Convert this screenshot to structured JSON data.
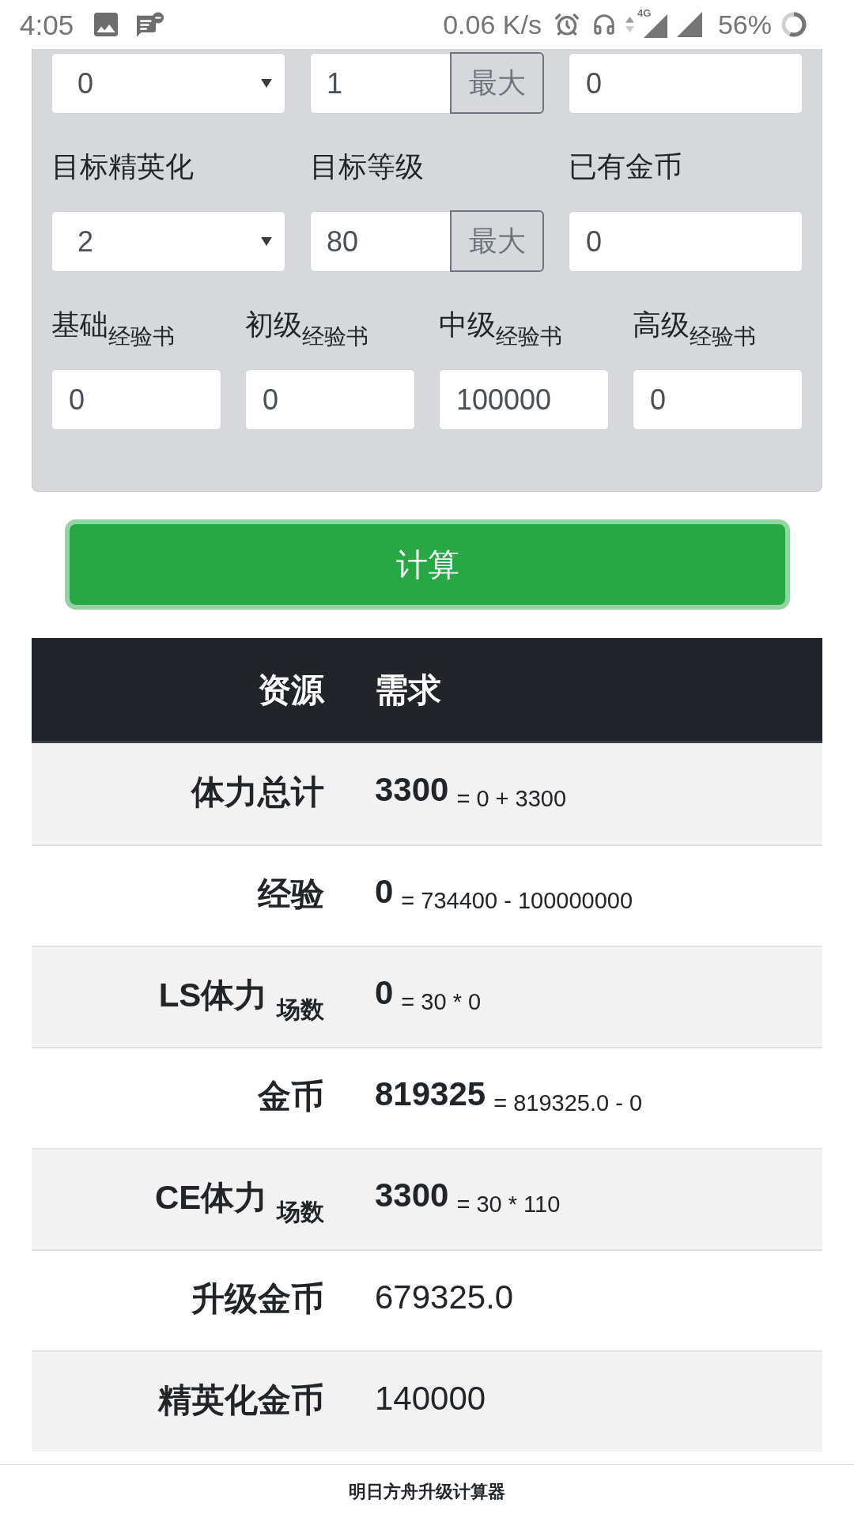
{
  "status_bar": {
    "time": "4:05",
    "network_speed": "0.06 K/s",
    "network_type": "4G",
    "battery": "56%"
  },
  "form": {
    "rows": [
      {
        "fields": [
          {
            "kind": "select",
            "value": "0"
          },
          {
            "kind": "input_max",
            "value": "1",
            "button": "最大"
          },
          {
            "kind": "input",
            "value": "0"
          }
        ]
      },
      {
        "fields": [
          {
            "kind": "select",
            "label": "目标精英化",
            "value": "2"
          },
          {
            "kind": "input_max",
            "label": "目标等级",
            "value": "80",
            "button": "最大"
          },
          {
            "kind": "input",
            "label": "已有金币",
            "value": "0"
          }
        ]
      },
      {
        "fields": [
          {
            "kind": "input",
            "label": "基础$_{经验书}$",
            "value": "0"
          },
          {
            "kind": "input",
            "label": "初级$_{经验书}$",
            "value": "0"
          },
          {
            "kind": "input",
            "label": "中级$_{经验书}$",
            "value": "100000"
          },
          {
            "kind": "input",
            "label": "高级$_{经验书}$",
            "value": "0"
          }
        ]
      }
    ]
  },
  "calculate_button": "计算",
  "table": {
    "columns": [
      "资源",
      "需求"
    ],
    "rows": [
      {
        "kind": "formula",
        "resource": "体力总计",
        "value": "3300",
        "formula": "= 0 + 3300"
      },
      {
        "kind": "formula",
        "resource": "经验",
        "value": "0",
        "formula": "= 734400 - 100000000"
      },
      {
        "kind": "formula",
        "resource": "LS体力 $_{场数}$",
        "value": "0",
        "formula": "= 30 * 0"
      },
      {
        "kind": "formula",
        "resource": "金币",
        "value": "819325",
        "formula": "= 819325.0 - 0"
      },
      {
        "kind": "formula",
        "resource": "CE体力 $_{场数}$",
        "value": "3300",
        "formula": "= 30 * 110"
      },
      {
        "kind": "plain",
        "resource": "升级金币",
        "value": "679325.0"
      },
      {
        "kind": "plain",
        "resource": "精英化金币",
        "value": "140000"
      }
    ]
  },
  "footer": "明日方舟升级计算器"
}
